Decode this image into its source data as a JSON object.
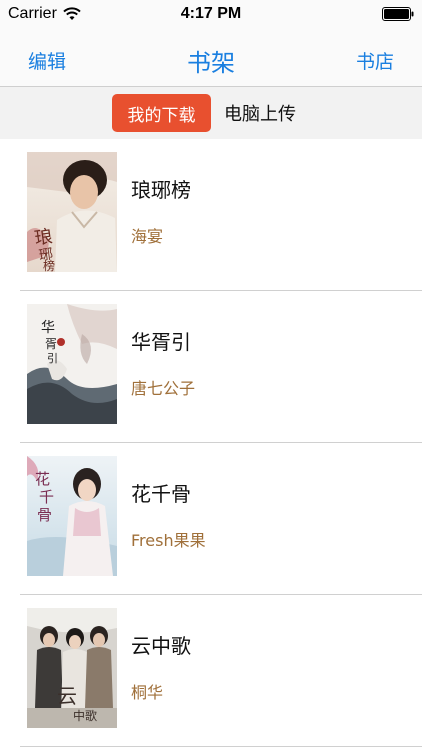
{
  "status_bar": {
    "carrier": "Carrier",
    "time": "4:17 PM",
    "wifi_icon": "wifi-icon",
    "battery_icon": "battery-icon"
  },
  "nav": {
    "left": "编辑",
    "title": "书架",
    "right": "书店",
    "accent_color": "#1a7fe0"
  },
  "segments": {
    "active": "我的下载",
    "inactive": "电脑上传",
    "active_color": "#e8502f"
  },
  "books": [
    {
      "title": "琅琊榜",
      "author": "海宴"
    },
    {
      "title": "华胥引",
      "author": "唐七公子"
    },
    {
      "title": "花千骨",
      "author": "Fresh果果"
    },
    {
      "title": "云中歌",
      "author": "桐华"
    }
  ],
  "author_color": "#a0703a"
}
